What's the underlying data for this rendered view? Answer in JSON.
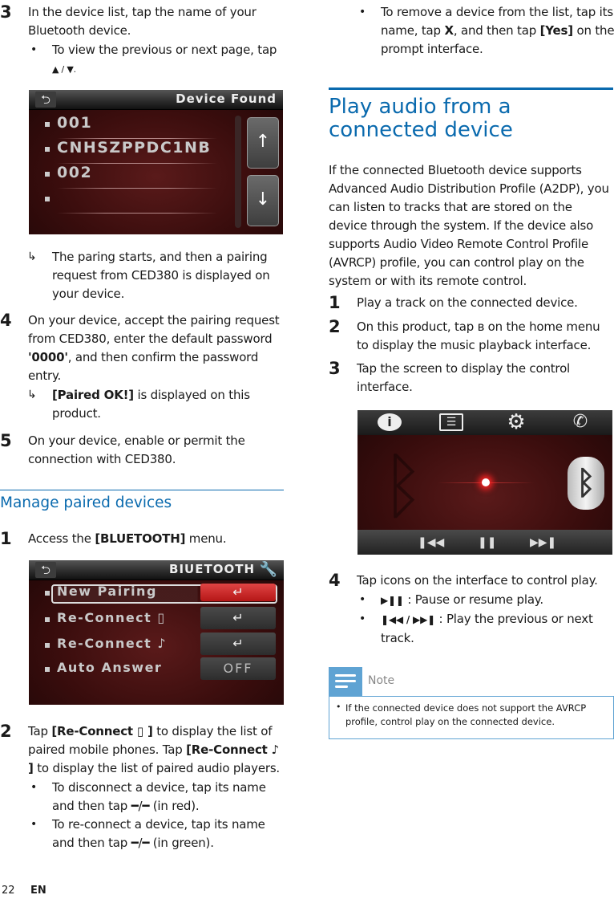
{
  "left": {
    "step3": {
      "num": "3",
      "text": "In the device list, tap the name of your Bluetooth device.",
      "bullet": "To view the previous or next page, tap",
      "bullet_icons": "▲ / ▼."
    },
    "device_found_screen": {
      "title": "Device Found",
      "back_icon": "⮌",
      "items": [
        "001",
        "CNHSZPPDC1NB",
        "002",
        ""
      ],
      "up_icon": "↑",
      "down_icon": "↓"
    },
    "result1": "The paring starts, and then a pairing request from CED380 is displayed on your device.",
    "step4": {
      "num": "4",
      "text_a": "On your device, accept the pairing request from CED380, enter the default password ",
      "password": "'0000'",
      "text_b": ", and then confirm the password entry.",
      "result_bold": "[Paired OK!]",
      "result_rest": " is displayed on this product."
    },
    "step5": {
      "num": "5",
      "text": "On your device, enable or permit the connection with CED380."
    },
    "section_title": "Manage paired devices",
    "mstep1": {
      "num": "1",
      "text_a": "Access the ",
      "bold": "[BLUETOOTH]",
      "text_b": " menu."
    },
    "bluetooth_screen": {
      "title": "BIUETOOTH",
      "items": [
        {
          "label": "New Pairing",
          "action": "↵"
        },
        {
          "label": "Re-Connect ▯",
          "action": "↵"
        },
        {
          "label": "Re-Connect ♪",
          "action": "↵"
        },
        {
          "label": "Auto Answer",
          "action": "OFF"
        }
      ]
    },
    "mstep2": {
      "num": "2",
      "tap1": "Tap ",
      "bold1": "[Re-Connect ▯ ]",
      "text1": " to display the list of paired mobile phones. Tap ",
      "bold2": "[Re-Connect ♪ ]",
      "text2": " to display the list of paired audio players.",
      "bullet1": "To disconnect a device, tap its name and then tap ━/━ (in red).",
      "bullet2": "To re-connect a device, tap its name and then tap ━/━ (in green)."
    }
  },
  "right": {
    "bullet_remove_a": "To remove a device from the list, tap its name, tap ",
    "bullet_remove_x": "X",
    "bullet_remove_b": ", and then tap ",
    "bullet_remove_yes": "[Yes]",
    "bullet_remove_c": " on the prompt interface.",
    "section_title": "Play audio from a connected device",
    "intro": "If the connected Bluetooth device supports Advanced Audio Distribution Profile (A2DP), you can listen to tracks that are stored on the device through the system. If the device also supports Audio Video Remote Control Profile (AVRCP) profile, you can control play on the system or with its remote control.",
    "steps": [
      {
        "num": "1",
        "text": "Play a track on the connected device."
      },
      {
        "num": "2",
        "text": "On this product, tap ʙ on the home menu to display the music playback interface."
      },
      {
        "num": "3",
        "text": "Tap the screen to display the control interface."
      }
    ],
    "control_screen": {
      "top_icons": [
        "info-icon",
        "list-icon",
        "settings-icon",
        "phone-icon"
      ],
      "bottom_icons": [
        "previous-icon",
        "pause-icon",
        "next-icon"
      ]
    },
    "step4": {
      "num": "4",
      "text": "Tap icons on the interface to control play.",
      "b1_icon": "▶❚❚",
      "b1_text": " : Pause or resume play.",
      "b2_icon": "❚◀◀ / ▶▶❚",
      "b2_text": " : Play the previous or next track."
    },
    "note": {
      "label": "Note",
      "text": "If the connected device does not support the AVRCP profile, control play on the connected device."
    }
  },
  "footer": {
    "page": "22",
    "lang": "EN"
  }
}
